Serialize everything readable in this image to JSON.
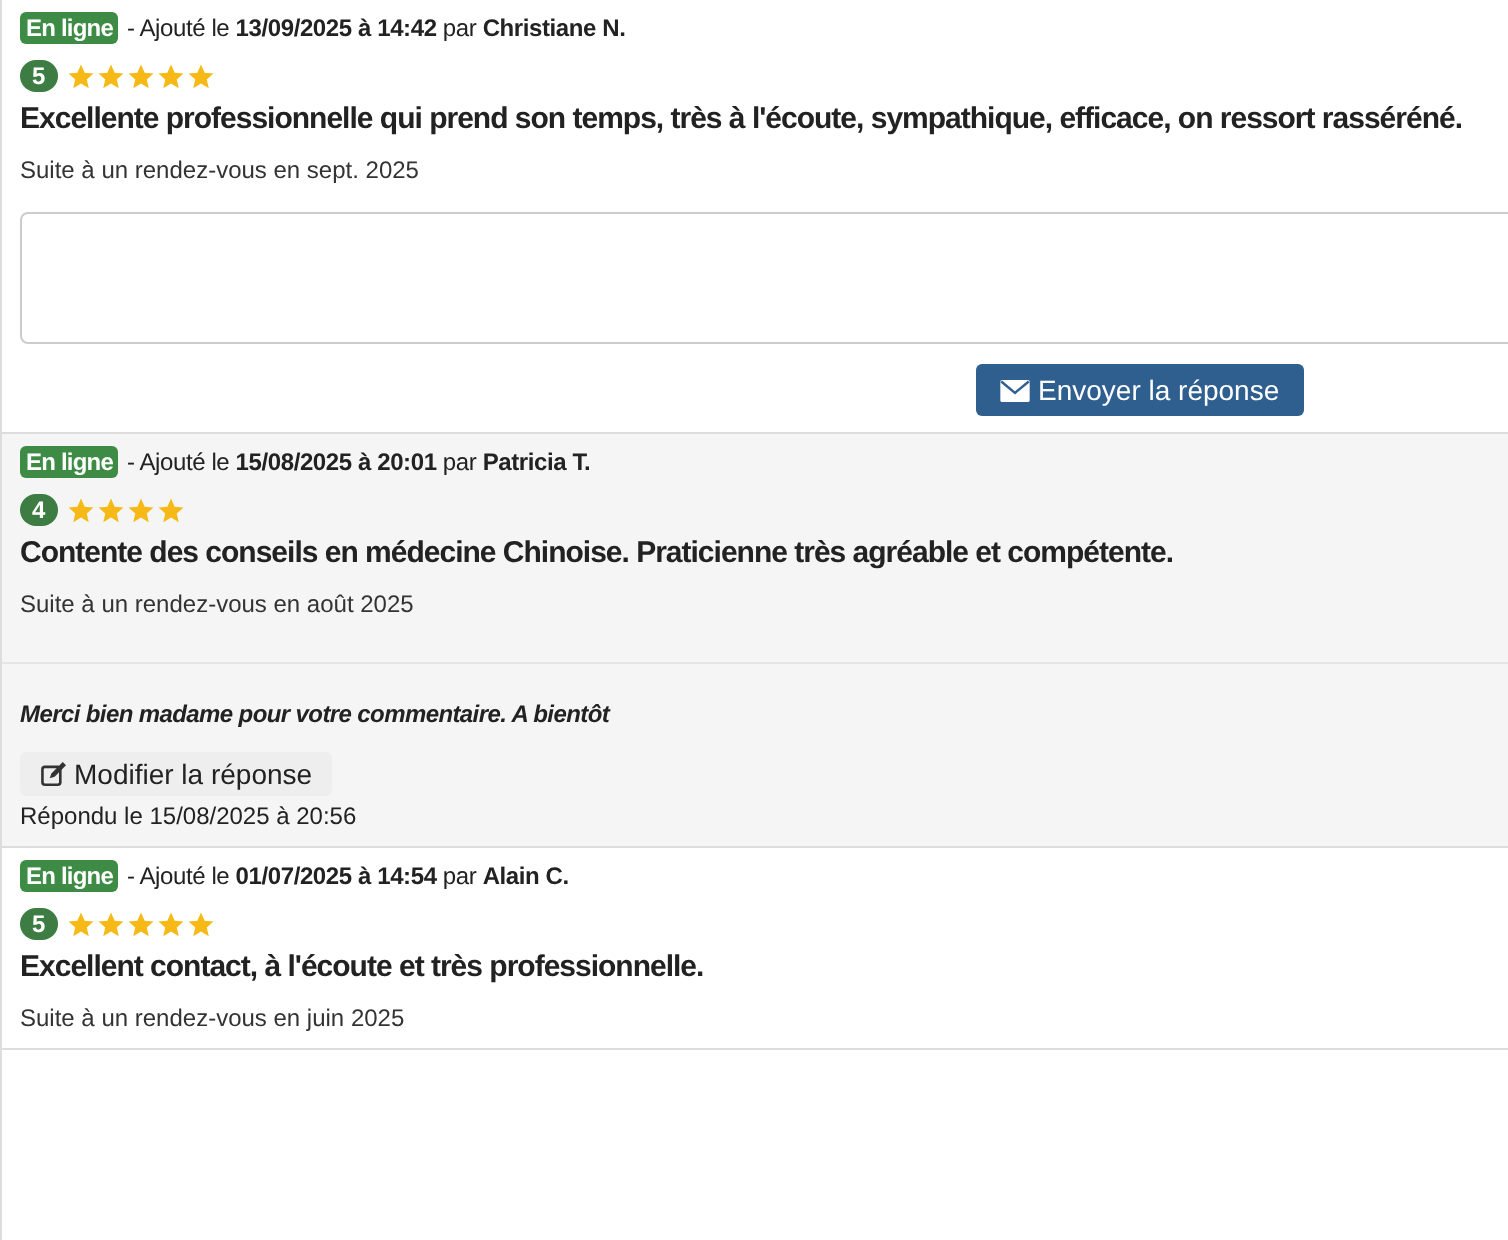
{
  "reviews": [
    {
      "status": "En ligne",
      "meta": "- Ajouté le **13/09/2025 à 14:42** par **Christiane N.**",
      "rating": "5",
      "stars": 5,
      "text": "Excellente professionnelle qui prend son temps, très à l'écoute, sympathique, efficace, on ressort rasséréné.",
      "context": "Suite à un rendez-vous en sept. 2025",
      "reply_form": {
        "button": "Envoyer la réponse"
      }
    },
    {
      "status": "En ligne",
      "meta": "- Ajouté le **15/08/2025 à 20:01** par **Patricia T.**",
      "rating": "4",
      "stars": 4,
      "text": "Contente des conseils en médecine Chinoise. Praticienne très agréable et compétente.",
      "context": "Suite à un rendez-vous en août 2025",
      "reply": {
        "text": "Merci bien madame pour votre commentaire. A bientôt",
        "button": "Modifier la réponse",
        "date": "Répondu le 15/08/2025 à 20:56"
      }
    },
    {
      "status": "En ligne",
      "meta": "- Ajouté le **01/07/2025 à 14:54** par **Alain C.**",
      "rating": "5",
      "stars": 5,
      "text": "Excellent contact, à l'écoute et très professionnelle.",
      "context": "Suite à un rendez-vous en juin 2025"
    }
  ]
}
